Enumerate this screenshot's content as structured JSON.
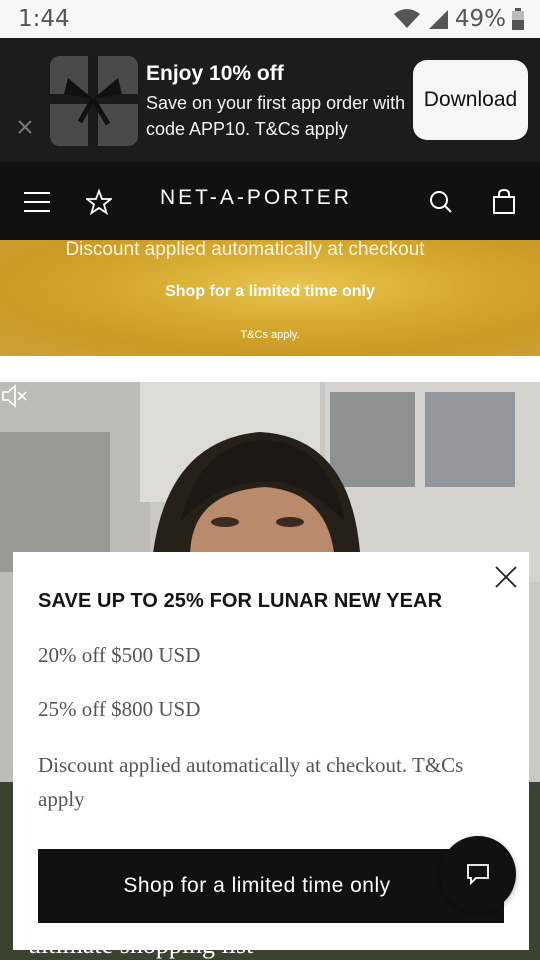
{
  "status_bar": {
    "time": "1:44",
    "battery": "49%",
    "icons": [
      "wifi-icon",
      "signal-icon",
      "battery-icon"
    ]
  },
  "app_banner": {
    "title": "Enjoy 10% off",
    "description": "Save on your first app order with code APP10. T&Cs apply",
    "download_label": "Download",
    "icons": [
      "close-icon",
      "gift-box-image"
    ]
  },
  "header": {
    "brand": "NET-A-PORTER",
    "icons": [
      "menu-icon",
      "star-icon",
      "search-icon",
      "shopping-bag-icon"
    ]
  },
  "promo_strip": {
    "line1": "Discount applied automatically at checkout",
    "line2": "Shop for a limited time only",
    "line3": "T&Cs apply."
  },
  "hero": {
    "caption": "ultimate shopping list",
    "icons": [
      "mute-icon"
    ]
  },
  "promo_modal": {
    "heading": "SAVE UP TO 25% FOR LUNAR NEW YEAR",
    "tier1": "20% off $500 USD",
    "tier2": "25% off $800 USD",
    "note": "Discount applied automatically at checkout. T&Cs apply",
    "cta_label": "Shop for a limited time only",
    "icons": [
      "close-icon"
    ]
  },
  "chat": {
    "icons": [
      "chat-icon"
    ]
  },
  "colors": {
    "banner_bg": "#1c1c1c",
    "header_bg": "#111111",
    "promo_gold": "#d5a92e",
    "cta_bg": "#111111"
  }
}
